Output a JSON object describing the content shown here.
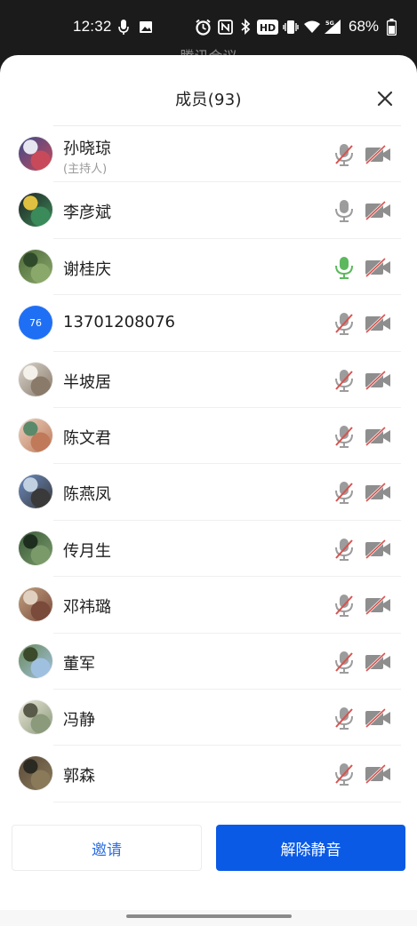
{
  "status_bar": {
    "time": "12:32",
    "battery_percent": "68%",
    "icons": [
      "mic-icon",
      "image-icon",
      "alarm-icon",
      "nfc-icon",
      "bluetooth-icon",
      "hd-icon",
      "vibrate-icon",
      "wifi-icon",
      "signal-5g-icon",
      "battery-icon"
    ]
  },
  "behind_title": "腾讯会议",
  "sheet": {
    "title": "成员(93)",
    "close_icon": "close-icon"
  },
  "members": [
    {
      "name": "孙晓琼",
      "role": "(主持人)",
      "avatar": "photo",
      "mic": "muted",
      "mic_color": "#d9534f",
      "cam": "off"
    },
    {
      "name": "李彦斌",
      "avatar": "photo",
      "mic": "on",
      "mic_color": "#9c9c9c",
      "cam": "off"
    },
    {
      "name": "谢桂庆",
      "avatar": "photo",
      "mic": "active",
      "mic_color": "#5cb85c",
      "cam": "off"
    },
    {
      "name": "13701208076",
      "avatar": "76",
      "mic": "muted",
      "mic_color": "#d9534f",
      "cam": "off"
    },
    {
      "name": "半坡居",
      "avatar": "photo",
      "mic": "muted",
      "mic_color": "#d9534f",
      "cam": "off"
    },
    {
      "name": "陈文君",
      "avatar": "photo",
      "mic": "muted",
      "mic_color": "#d9534f",
      "cam": "off"
    },
    {
      "name": "陈燕凤",
      "avatar": "photo",
      "mic": "muted",
      "mic_color": "#d9534f",
      "cam": "off"
    },
    {
      "name": "传月生",
      "avatar": "photo",
      "mic": "muted",
      "mic_color": "#d9534f",
      "cam": "off"
    },
    {
      "name": "邓祎璐",
      "avatar": "photo",
      "mic": "muted",
      "mic_color": "#d9534f",
      "cam": "off"
    },
    {
      "name": "董军",
      "avatar": "photo",
      "mic": "muted",
      "mic_color": "#d9534f",
      "cam": "off"
    },
    {
      "name": "冯静",
      "avatar": "photo",
      "mic": "muted",
      "mic_color": "#d9534f",
      "cam": "off"
    },
    {
      "name": "郭森",
      "avatar": "photo",
      "mic": "muted",
      "mic_color": "#d9534f",
      "cam": "off"
    }
  ],
  "buttons": {
    "invite_label": "邀请",
    "unmute_label": "解除静音"
  },
  "colors": {
    "accent": "#0a5ae6",
    "muted_red": "#d9534f",
    "cam_gray": "#8e8e8e"
  }
}
